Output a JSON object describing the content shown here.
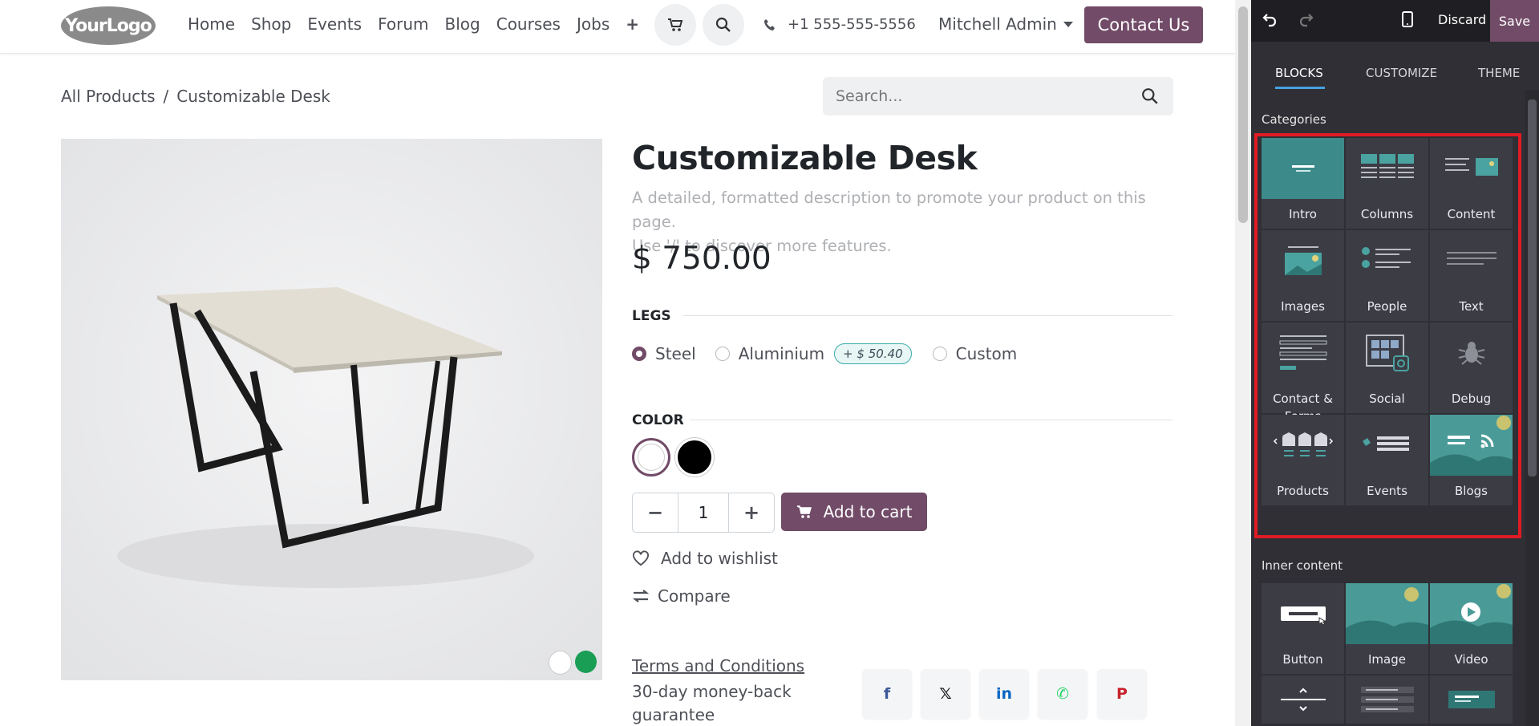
{
  "header": {
    "logo_text": "YourLogo",
    "nav": [
      "Home",
      "Shop",
      "Events",
      "Forum",
      "Blog",
      "Courses",
      "Jobs"
    ],
    "nav_plus": "+",
    "phone": "+1 555-555-5556",
    "user": "Mitchell Admin",
    "contact_label": "Contact Us"
  },
  "breadcrumb": {
    "root": "All Products",
    "separator": "/",
    "current": "Customizable Desk"
  },
  "search": {
    "placeholder": "Search..."
  },
  "product": {
    "title": "Customizable Desk",
    "description_line1": "A detailed, formatted description to promote your product on this page.",
    "description_line2": "Use '/' to discover more features.",
    "price": "$ 750.00",
    "legs_label": "LEGS",
    "legs_options": [
      {
        "label": "Steel",
        "selected": true
      },
      {
        "label": "Aluminium",
        "selected": false,
        "extra": "+ $ 50.40"
      },
      {
        "label": "Custom",
        "selected": false
      }
    ],
    "color_label": "COLOR",
    "colors": [
      {
        "name": "white",
        "hex": "#ffffff",
        "selected": true
      },
      {
        "name": "black",
        "hex": "#000000",
        "selected": false
      }
    ],
    "quantity": "1",
    "add_to_cart": "Add to cart",
    "wishlist": "Add to wishlist",
    "compare": "Compare",
    "terms": "Terms and Conditions",
    "guarantee": "30-day money-back guarantee",
    "share": [
      "facebook-icon",
      "x-icon",
      "linkedin-icon",
      "whatsapp-icon",
      "pinterest-icon"
    ]
  },
  "editor": {
    "discard": "Discard",
    "save": "Save",
    "tabs": [
      "BLOCKS",
      "CUSTOMIZE",
      "THEME"
    ],
    "active_tab": "BLOCKS",
    "categories_label": "Categories",
    "categories": [
      {
        "name": "Intro"
      },
      {
        "name": "Columns"
      },
      {
        "name": "Content"
      },
      {
        "name": "Images"
      },
      {
        "name": "People"
      },
      {
        "name": "Text"
      },
      {
        "name": "Contact & Forms"
      },
      {
        "name": "Social"
      },
      {
        "name": "Debug"
      },
      {
        "name": "Products"
      },
      {
        "name": "Events"
      },
      {
        "name": "Blogs"
      }
    ],
    "inner_label": "Inner content",
    "inner": [
      {
        "name": "Button"
      },
      {
        "name": "Image"
      },
      {
        "name": "Video"
      }
    ]
  },
  "colors": {
    "brand": "#714b67",
    "teal": "#3aadaa",
    "highlight": "#e01b24",
    "editor_bg": "#2f2f35"
  }
}
